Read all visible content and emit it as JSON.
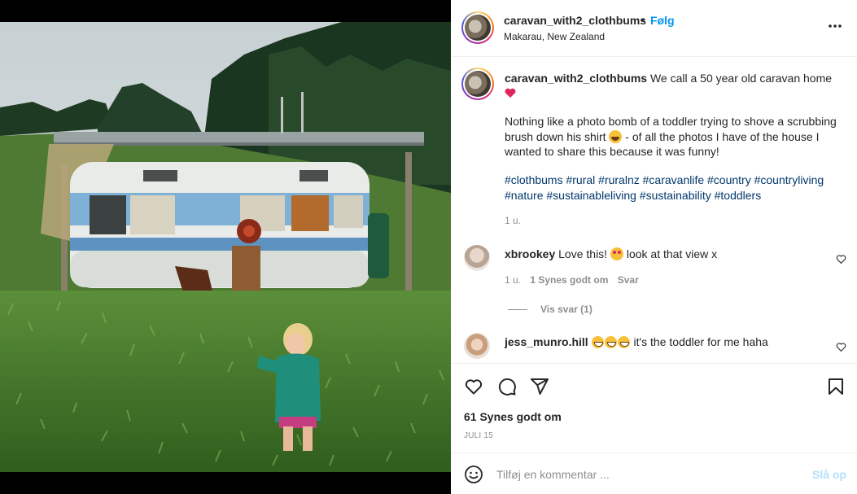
{
  "header": {
    "username": "caravan_with2_clothbums",
    "dot": "•",
    "follow_label": "Følg",
    "location": "Makarau, New Zealand",
    "more_icon": "more-horizontal-icon"
  },
  "caption": {
    "username": "caravan_with2_clothbums",
    "line1": "We call a 50 year old caravan home",
    "heart_emoji": "heart-emoji",
    "paragraph_a": "Nothing like a photo bomb of a toddler trying to shove a scrubbing brush down his shirt",
    "paragraph_b": "- of all the photos I have of the house I wanted to share this because it was funny!",
    "hashtags": "#clothbums #rural #ruralnz #caravanlife #country #countryliving #nature #sustainableliving #sustainability #toddlers",
    "time": "1 u."
  },
  "comments": [
    {
      "username": "xbrookey",
      "text_a": "Love this!",
      "text_b": "look at that view x",
      "time": "1 u.",
      "likes": "1 Synes godt om",
      "reply": "Svar",
      "view_replies": "Vis svar (1)"
    },
    {
      "username": "jess_munro.hill",
      "text": "it's the toddler for me haha"
    }
  ],
  "actions": {
    "like_icon": "heart-icon",
    "comment_icon": "comment-icon",
    "share_icon": "send-icon",
    "save_icon": "bookmark-icon",
    "likes": "61 Synes godt om",
    "date": "JULI 15"
  },
  "add_comment": {
    "placeholder": "Tilføj en kommentar ...",
    "post_label": "Slå op"
  },
  "colors": {
    "accent": "#0095f6",
    "link": "#00376b",
    "muted": "#8e8e8e",
    "post_disabled": "#b2dffc"
  }
}
